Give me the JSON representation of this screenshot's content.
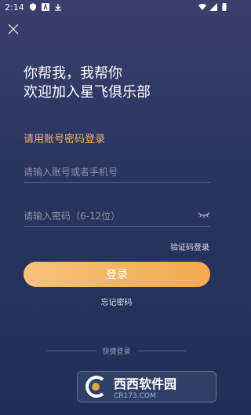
{
  "status_bar": {
    "time": "2:14"
  },
  "welcome": {
    "line1": "你帮我，我帮你",
    "line2": "欢迎加入星飞俱乐部"
  },
  "login": {
    "subtitle": "请用账号密码登录",
    "account_placeholder": "请输入账号或者手机号",
    "password_placeholder": "请输入密码（6-12位）",
    "code_login_label": "验证码登录",
    "login_button_label": "登录",
    "forgot_password_label": "忘记密码",
    "quick_login_label": "快捷登录"
  },
  "watermark": {
    "title": "西西软件园",
    "domain": "CR173.COM"
  },
  "colors": {
    "accent": "#f2b26b",
    "button_gradient_start": "#f6c27c",
    "button_gradient_end": "#f3a94f",
    "background_top": "#3a3f6e",
    "background_bottom": "#1f2f58"
  }
}
